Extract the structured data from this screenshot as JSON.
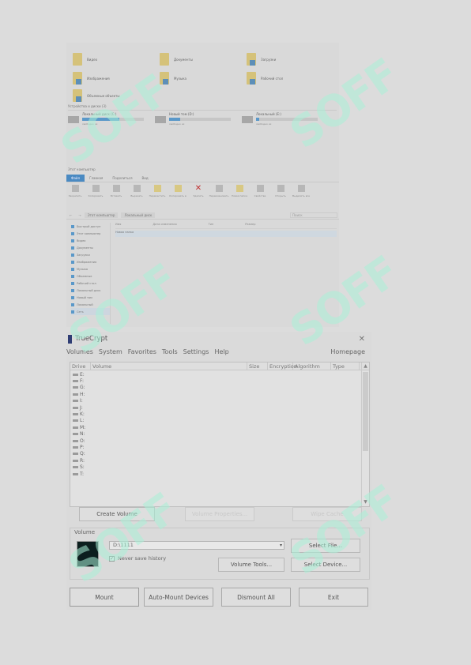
{
  "explorer": {
    "folders": [
      {
        "label": "Видео",
        "icon": "video-folder-icon"
      },
      {
        "label": "Документы",
        "icon": "documents-folder-icon"
      },
      {
        "label": "Загрузки",
        "icon": "downloads-folder-icon"
      },
      {
        "label": "Изображения",
        "icon": "pictures-folder-icon"
      },
      {
        "label": "Музыка",
        "icon": "music-folder-icon"
      },
      {
        "label": "Рабочий стол",
        "icon": "desktop-folder-icon"
      },
      {
        "label": "Объемные объекты",
        "icon": "3d-objects-folder-icon"
      }
    ],
    "drives_header": "Устройства и диски (3)",
    "drives": [
      {
        "name": "Локальный диск (C:)",
        "used": 0.6,
        "free": "свободно из"
      },
      {
        "name": "Новый том (D:)",
        "used": 0.18,
        "free": "свободно из"
      },
      {
        "name": "Локальный (E:)",
        "used": 0.05,
        "free": "свободно из"
      }
    ],
    "ribbon_title": "Этот компьютер",
    "ribbon_tabs": [
      "Файл",
      "Главная",
      "Поделиться",
      "Вид"
    ],
    "ribbon_buttons": [
      "Закрепить",
      "Копировать",
      "Вставить",
      "Вырезать",
      "Переместить",
      "Копировать в",
      "Удалить",
      "Переименовать",
      "Новая папка",
      "Свойства",
      "Открыть",
      "Выделить все"
    ],
    "address_crumbs": [
      "Этот компьютер",
      "Локальный диск"
    ],
    "search_placeholder": "Поиск",
    "nav_items": [
      "Быстрый доступ",
      "Этот компьютер",
      "Видео",
      "Документы",
      "Загрузки",
      "Изображения",
      "Музыка",
      "Объемные",
      "Рабочий стол",
      "Локальный диск",
      "Новый том",
      "Локальный",
      "Сеть"
    ],
    "file_columns": [
      "Имя",
      "Дата изменения",
      "Тип",
      "Размер"
    ],
    "file_rows": [
      {
        "name": "Новая папка",
        "date": "",
        "type": "",
        "size": ""
      }
    ]
  },
  "truecrypt": {
    "title": "TrueCrypt",
    "menu": [
      "Volumes",
      "System",
      "Favorites",
      "Tools",
      "Settings",
      "Help"
    ],
    "homepage": "Homepage",
    "columns": [
      "Drive",
      "Volume",
      "Size",
      "Encryption",
      "Algorithm",
      "Type"
    ],
    "drives": [
      "E:",
      "F:",
      "G:",
      "H:",
      "I:",
      "J:",
      "K:",
      "L:",
      "M:",
      "N:",
      "O:",
      "P:",
      "Q:",
      "R:",
      "S:",
      "T:"
    ],
    "buttons": {
      "create_volume": "Create Volume",
      "volume_properties": "Volume Properties...",
      "wipe_cache": "Wipe Cache",
      "select_file": "Select File...",
      "volume_tools": "Volume Tools...",
      "select_device": "Select Device...",
      "mount": "Mount",
      "auto_mount": "Auto-Mount Devices",
      "dismount_all": "Dismount All",
      "exit": "Exit"
    },
    "volume_group_label": "Volume",
    "volume_path": "D:\\1111",
    "never_save_history_label": "Never save history",
    "never_save_history_checked": true
  },
  "watermark": "SOFF"
}
